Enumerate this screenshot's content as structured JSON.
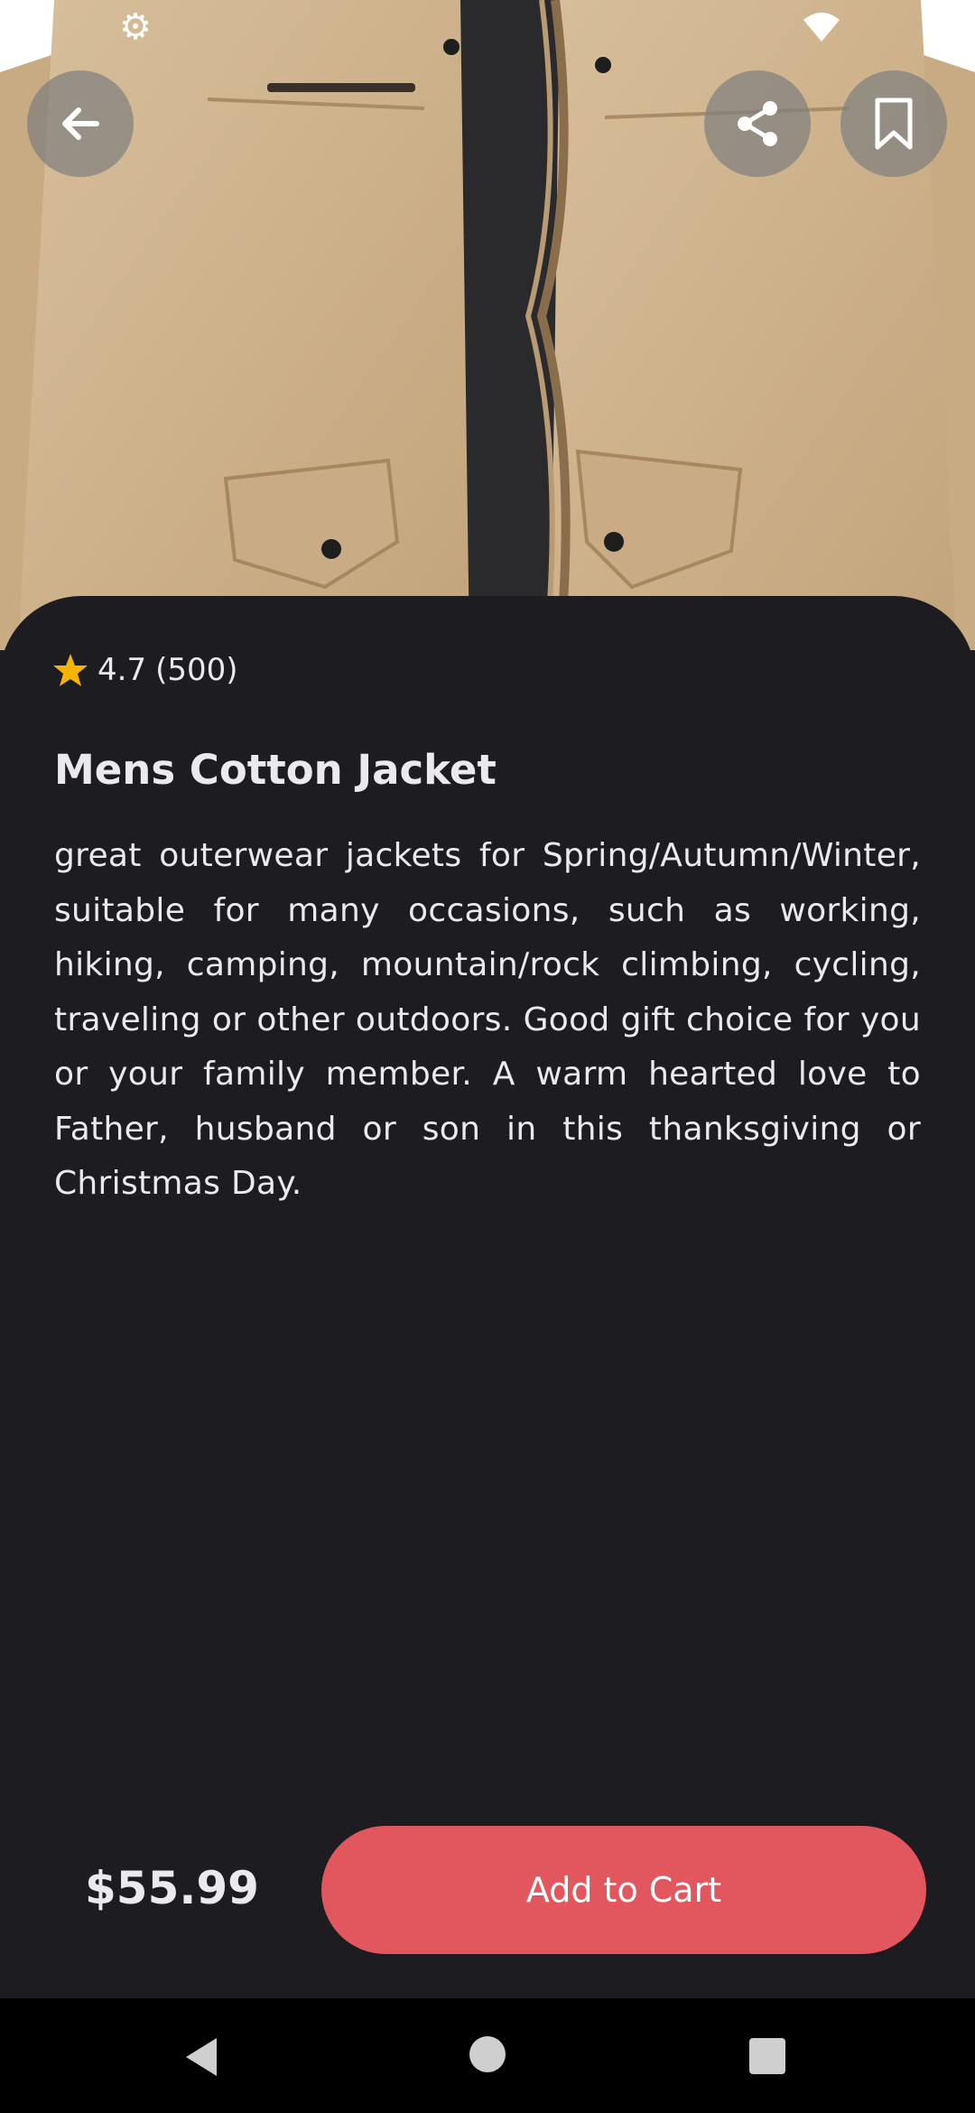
{
  "product": {
    "image": "tan-cotton-jacket",
    "rating": "4.7",
    "reviews": "(500)",
    "title": "Mens Cotton Jacket",
    "description": "great outerwear jackets for Spring/Autumn/Winter, suitable for many occasions, such as working, hiking, camping, mountain/rock climbing, cycling, traveling or other outdoors. Good gift choice for you or your family member. A warm hearted love to Father, husband or son in this thanksgiving or Christmas Day.",
    "price": "$55.99"
  },
  "actions": {
    "add_to_cart": "Add to Cart"
  },
  "icons": {
    "back": "arrow-left-icon",
    "share": "share-icon",
    "bookmark": "bookmark-icon",
    "star": "star-icon"
  },
  "colors": {
    "background": "#1d1c21",
    "accent": "#e2565e",
    "star": "#f5b400",
    "text": "#ece9ee"
  }
}
